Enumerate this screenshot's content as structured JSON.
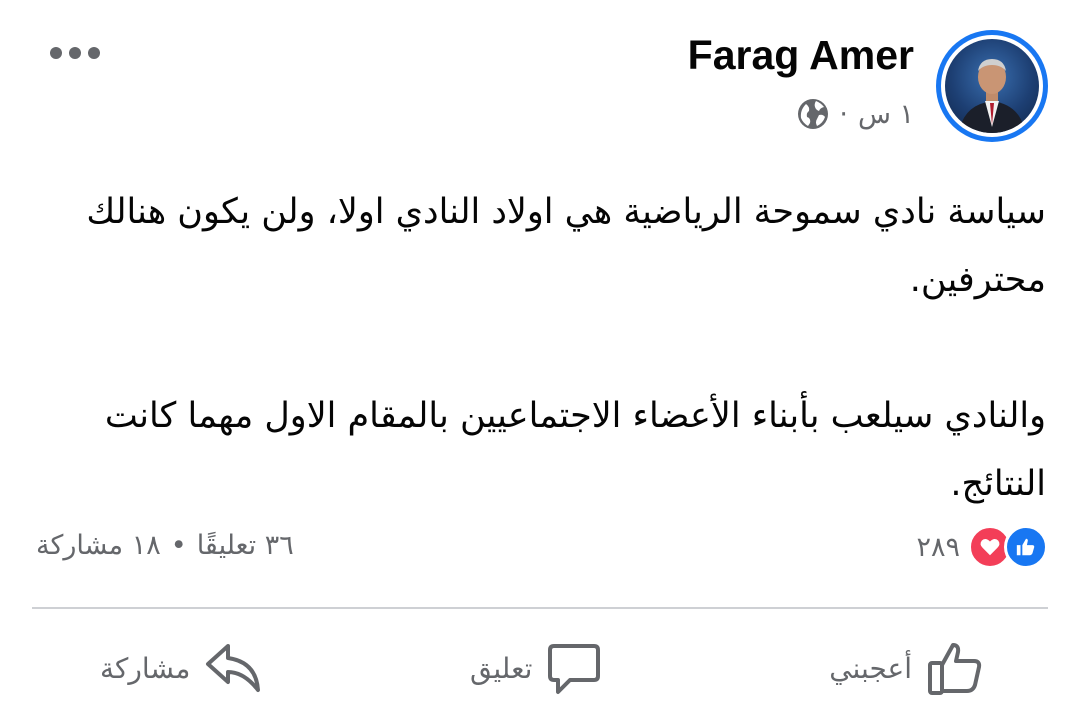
{
  "post": {
    "author": "Farag Amer",
    "time": "١ س",
    "separator": "·",
    "privacy_icon": "globe-icon",
    "paragraph_1": "سياسة نادي سموحة الرياضية هي اولاد النادي اولا، ولن يكون هنالك محترفين.",
    "paragraph_2": "والنادي سيلعب بأبناء الأعضاء الاجتماعيين بالمقام الاول مهما كانت النتائج."
  },
  "reactions": {
    "count": "٢٨٩",
    "icons": [
      "like-icon",
      "love-icon"
    ],
    "like_color": "#1877f2",
    "love_color": "#f33e58"
  },
  "engagement": {
    "comments": "٣٦ تعليقًا",
    "dot": "•",
    "shares": "١٨ مشاركة"
  },
  "actions": {
    "like": "أعجبني",
    "comment": "تعليق",
    "share": "مشاركة"
  },
  "colors": {
    "accent": "#1877f2",
    "secondary_text": "#65676b",
    "divider": "#ced0d4"
  }
}
